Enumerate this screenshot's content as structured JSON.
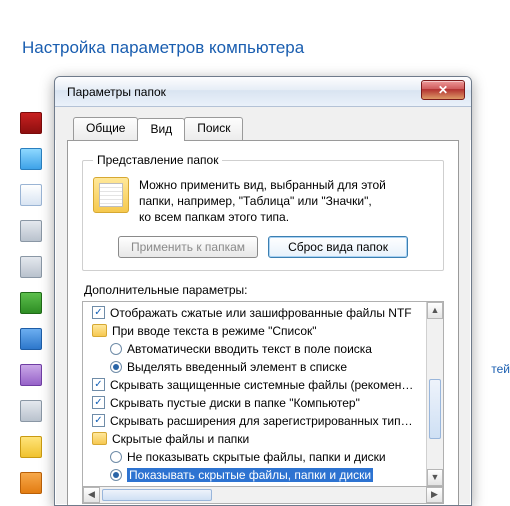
{
  "page_header": "Настройка параметров компьютера",
  "dialog": {
    "title": "Параметры папок",
    "close_symbol": "✕",
    "tabs": {
      "general": "Общие",
      "view": "Вид",
      "search": "Поиск"
    },
    "group_legend": "Представление папок",
    "group_text_l1": "Можно применить вид, выбранный для этой",
    "group_text_l2": "папки, например, \"Таблица\" или \"Значки\",",
    "group_text_l3": "ко всем папкам этого типа.",
    "btn_apply": "Применить к папкам",
    "btn_reset": "Сброс вида папок",
    "advanced_label": "Дополнительные параметры:",
    "tree": {
      "item0": "Отображать сжатые или зашифрованные файлы NTF",
      "item1": "При вводе текста в режиме \"Список\"",
      "item2": "Автоматически вводить текст в поле поиска",
      "item3": "Выделять введенный элемент в списке",
      "item4": "Скрывать защищенные системные файлы (рекомен…",
      "item5": "Скрывать пустые диски в папке \"Компьютер\"",
      "item6": "Скрывать расширения для зарегистрированных тип…",
      "item7": "Скрытые файлы и папки",
      "item8": "Не показывать скрытые файлы, папки и диски",
      "item9": "Показывать скрытые файлы, папки и диски"
    }
  },
  "partial_link": "тей",
  "scroll": {
    "up": "▲",
    "down": "▼",
    "left": "◀",
    "right": "▶"
  }
}
